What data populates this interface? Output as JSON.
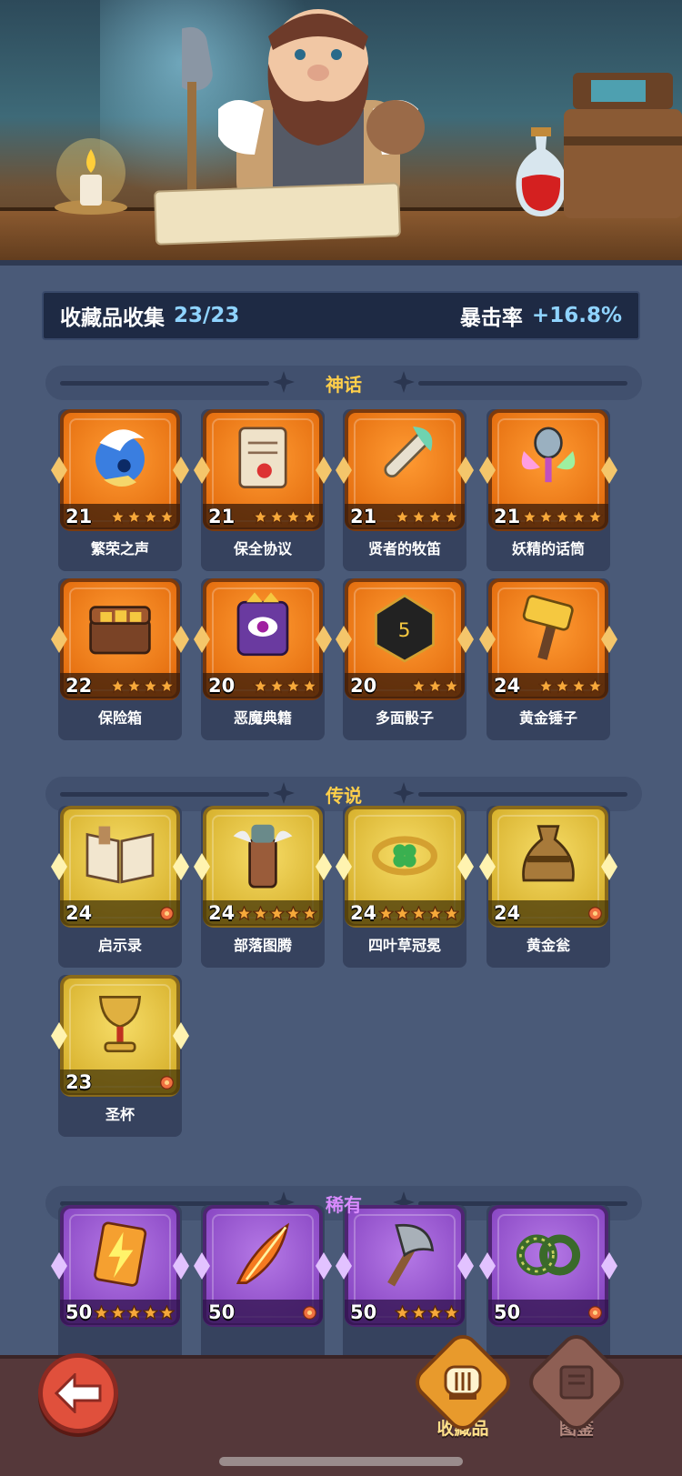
{
  "summary": {
    "label": "收藏品收集",
    "count": "23/23",
    "crit_label": "暴击率",
    "crit_value": "+16.8%"
  },
  "sections": {
    "mythic": {
      "title": "神话",
      "items": [
        {
          "name": "繁荣之声",
          "level": "21",
          "stars": 4,
          "icon": "blue-orb-icon"
        },
        {
          "name": "保全协议",
          "level": "21",
          "stars": 4,
          "icon": "contract-scroll-icon"
        },
        {
          "name": "贤者的牧笛",
          "level": "21",
          "stars": 4,
          "icon": "flute-icon"
        },
        {
          "name": "妖精的话筒",
          "level": "21",
          "stars": 5,
          "icon": "fairy-microphone-icon"
        },
        {
          "name": "保险箱",
          "level": "22",
          "stars": 4,
          "icon": "treasure-chest-icon"
        },
        {
          "name": "恶魔典籍",
          "level": "20",
          "stars": 4,
          "icon": "demon-book-icon"
        },
        {
          "name": "多面骰子",
          "level": "20",
          "stars": 3,
          "icon": "dice-icon"
        },
        {
          "name": "黄金锤子",
          "level": "24",
          "stars": 4,
          "icon": "golden-hammer-icon"
        }
      ]
    },
    "legend": {
      "title": "传说",
      "items": [
        {
          "name": "启示录",
          "level": "24",
          "stars": 1,
          "icon": "open-book-icon"
        },
        {
          "name": "部落图腾",
          "level": "24",
          "stars": 5,
          "icon": "totem-icon"
        },
        {
          "name": "四叶草冠冕",
          "level": "24",
          "stars": 5,
          "icon": "clover-crown-icon"
        },
        {
          "name": "黄金瓮",
          "level": "24",
          "stars": 1,
          "icon": "golden-urn-icon"
        },
        {
          "name": "圣杯",
          "level": "23",
          "stars": 1,
          "icon": "chalice-icon"
        }
      ]
    },
    "rare": {
      "title": "稀有",
      "items": [
        {
          "name": "",
          "level": "50",
          "stars": 5,
          "icon": "lightning-card-icon"
        },
        {
          "name": "",
          "level": "50",
          "stars": 1,
          "icon": "flame-feather-icon"
        },
        {
          "name": "",
          "level": "50",
          "stars": 4,
          "icon": "axe-icon"
        },
        {
          "name": "",
          "level": "50",
          "stars": 1,
          "icon": "thorn-ring-icon"
        }
      ]
    }
  },
  "nav": {
    "collectibles_label": "收藏品",
    "codex_label": "图鉴"
  },
  "colors": {
    "mythic_orange": "#e56f10",
    "legend_gold": "#d8b22e",
    "rare_purple": "#8a48c4",
    "accent_blue": "#8fd3ff",
    "header_gold": "#ffcf4a"
  }
}
